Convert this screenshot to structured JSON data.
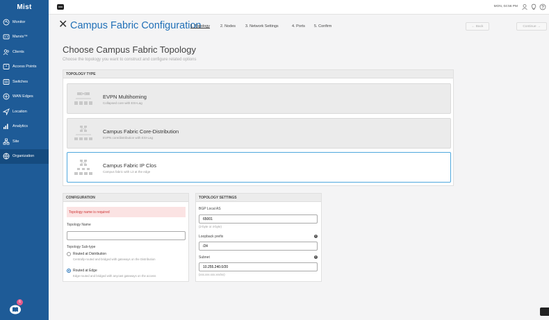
{
  "sidebar": {
    "logo": "Mist",
    "items": [
      {
        "label": "Monitor",
        "icon": "monitor-icon"
      },
      {
        "label": "Marvis™",
        "icon": "marvis-icon"
      },
      {
        "label": "Clients",
        "icon": "clients-icon"
      },
      {
        "label": "Access Points",
        "icon": "access-point-icon"
      },
      {
        "label": "Switches",
        "icon": "switch-icon"
      },
      {
        "label": "WAN Edges",
        "icon": "wan-edge-icon"
      },
      {
        "label": "Location",
        "icon": "location-icon"
      },
      {
        "label": "Analytics",
        "icon": "analytics-icon"
      },
      {
        "label": "Site",
        "icon": "site-icon"
      },
      {
        "label": "Organization",
        "icon": "organization-icon"
      }
    ],
    "active_item": "Organization",
    "help_badge": "6"
  },
  "topbar": {
    "datetime": "MON, 04:56 PM"
  },
  "header": {
    "title": "Campus Fabric Configuration",
    "steps": [
      "1. Topology",
      "2. Nodes",
      "3. Network Settings",
      "4. Ports",
      "5. Confirm"
    ],
    "active_step": "1. Topology",
    "back_label": "← Back",
    "continue_label": "Continue →"
  },
  "main": {
    "heading": "Choose Campus Fabric Topology",
    "subheading": "Choose the topology you want to construct and configure related options"
  },
  "topology_type": {
    "title": "TOPOLOGY TYPE",
    "options": [
      {
        "name": "EVPN Multihoming",
        "desc": "Collapsed core with ESI-Lag",
        "selected": false
      },
      {
        "name": "Campus Fabric Core-Distribution",
        "desc": "EVPN core/distribution with ESI-Lag",
        "selected": false
      },
      {
        "name": "Campus Fabric IP Clos",
        "desc": "Campus fabric with L3 at the edge",
        "selected": true
      }
    ]
  },
  "configuration": {
    "title": "CONFIGURATION",
    "error": "Topology name is required",
    "name_label": "Topology Name",
    "name_value": "",
    "subtype_label": "Topology Sub-type",
    "subtypes": [
      {
        "label": "Routed at Distribution",
        "desc": "Centrally-routed and bridged with gateways on the Distribution",
        "selected": false
      },
      {
        "label": "Routed at Edge",
        "desc": "Edge-routed and bridged with anycast gateways on the access",
        "selected": true
      }
    ]
  },
  "topology_settings": {
    "title": "TOPOLOGY SETTINGS",
    "bgp_label": "BGP Local AS",
    "bgp_value": "65001",
    "bgp_hint": "(2-byte or 4-byte)",
    "loopback_label": "Loopback prefix",
    "loopback_value": "/24",
    "subnet_label": "Subnet",
    "subnet_value": "10.255.240.0/20",
    "subnet_hint": "(xxx.xxx.xxx.xxx/xx)"
  },
  "colors": {
    "sidebar": "#1e5b97",
    "accent": "#1f6fb7",
    "selected_border": "#4fa7dd",
    "error_bg": "#fbe3e3",
    "error_text": "#cc3333"
  }
}
